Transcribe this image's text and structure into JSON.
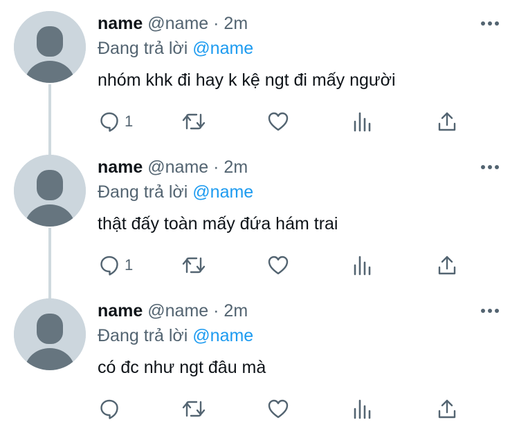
{
  "tweets": [
    {
      "name": "name",
      "handle": "@name",
      "separator": "·",
      "time": "2m",
      "replying_prefix": "Đang trả lời",
      "replying_to": "@name",
      "text": "nhóm khk đi hay k kệ ngt đi mấy người",
      "reply_count": "1"
    },
    {
      "name": "name",
      "handle": "@name",
      "separator": "·",
      "time": "2m",
      "replying_prefix": "Đang trả lời",
      "replying_to": "@name",
      "text": "thật đấy toàn mấy đứa hám trai",
      "reply_count": "1"
    },
    {
      "name": "name",
      "handle": "@name",
      "separator": "·",
      "time": "2m",
      "replying_prefix": "Đang trả lời",
      "replying_to": "@name",
      "text": "có đc như ngt đâu mà",
      "reply_count": ""
    }
  ],
  "colors": {
    "text_primary": "#0f1419",
    "text_secondary": "#536471",
    "mention": "#1d9bf0",
    "avatar_bg": "#ccd6dd",
    "avatar_figure": "#66757f",
    "thread_line": "#cfd9de"
  },
  "icons": [
    "more-icon",
    "reply-icon",
    "retweet-icon",
    "like-icon",
    "analytics-icon",
    "share-icon"
  ]
}
